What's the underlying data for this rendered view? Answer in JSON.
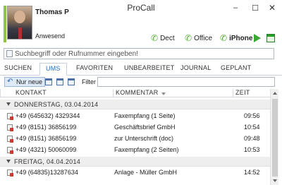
{
  "window": {
    "title": "ProCall",
    "minimize": "–",
    "maximize": "☐",
    "close": "✕"
  },
  "user": {
    "name": "Thomas P",
    "status": "Anwesend",
    "status_color": "#8dc53e"
  },
  "devices": [
    {
      "label": "Dect",
      "icon": "phone-icon"
    },
    {
      "label": "Office",
      "icon": "phone-icon"
    },
    {
      "label": "iPhone",
      "icon": "phone-icon",
      "active": true
    }
  ],
  "search": {
    "placeholder": "Suchbegriff oder Rufnummer eingeben!",
    "value": ""
  },
  "tabs": [
    {
      "label": "SUCHEN"
    },
    {
      "label": "UMS",
      "active": true
    },
    {
      "label": "FAVORITEN"
    },
    {
      "label": "UNBEARBEITET"
    },
    {
      "label": "JOURNAL"
    },
    {
      "label": "GEPLANT"
    }
  ],
  "toolbar": {
    "nur_neue": "Nur neue",
    "filter_label": "Filter",
    "filter_value": ""
  },
  "table": {
    "columns": {
      "contact": "KONTAKT",
      "comment": "KOMMENTAR",
      "time": "ZEIT"
    },
    "groups": [
      {
        "label": "DONNERSTAG, 03.04.2014",
        "rows": [
          {
            "contact": "+49 (645632) 4329344",
            "comment": "Faxempfang (1 Seite)",
            "time": "09:56"
          },
          {
            "contact": "+49 (8151) 36856199",
            "comment": "Geschäftsbrief GmbH",
            "time": "10:54"
          },
          {
            "contact": "+49 (8151) 36856199",
            "comment": "zur Unterschrift (doc)",
            "time": "09:48"
          },
          {
            "contact": "+49 (4321) 50060099",
            "comment": "Faxempfang (2 Seiten)",
            "time": "10:53"
          }
        ]
      },
      {
        "label": "FREITAG, 04.04.2014",
        "rows": [
          {
            "contact": "+49 (64835)13287634",
            "comment": "Anlage - Müller GmbH",
            "time": "14:52"
          }
        ]
      }
    ]
  },
  "colors": {
    "accent": "#1c6fc3",
    "phone_green": "#4cae2b",
    "fax_red": "#d13a2b"
  }
}
